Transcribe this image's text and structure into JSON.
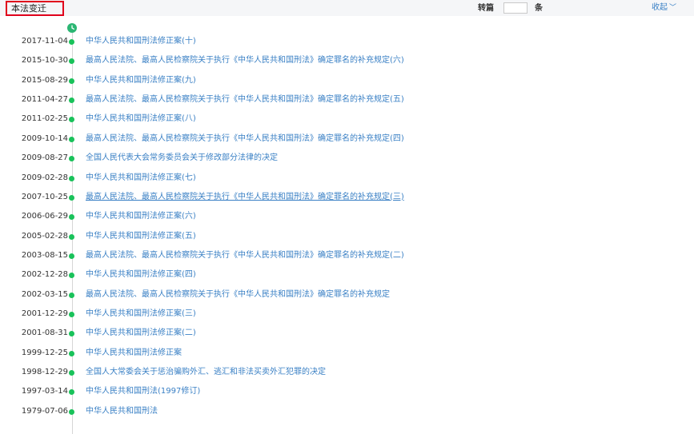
{
  "header": {
    "section_title": "本法变迁",
    "jump_label": "转篇",
    "jump_input_value": "",
    "jump_unit": "条",
    "collapse_label": "收起"
  },
  "timeline": {
    "events": [
      {
        "date": "2017-11-04",
        "title": "中华人民共和国刑法修正案(十)"
      },
      {
        "date": "2015-10-30",
        "title": "最高人民法院、最高人民检察院关于执行《中华人民共和国刑法》确定罪名的补充规定(六)"
      },
      {
        "date": "2015-08-29",
        "title": "中华人民共和国刑法修正案(九)"
      },
      {
        "date": "2011-04-27",
        "title": "最高人民法院、最高人民检察院关于执行《中华人民共和国刑法》确定罪名的补充规定(五)"
      },
      {
        "date": "2011-02-25",
        "title": "中华人民共和国刑法修正案(八)"
      },
      {
        "date": "2009-10-14",
        "title": "最高人民法院、最高人民检察院关于执行《中华人民共和国刑法》确定罪名的补充规定(四)"
      },
      {
        "date": "2009-08-27",
        "title": "全国人民代表大会常务委员会关于修改部分法律的决定"
      },
      {
        "date": "2009-02-28",
        "title": "中华人民共和国刑法修正案(七)"
      },
      {
        "date": "2007-10-25",
        "title": "最高人民法院、最高人民检察院关于执行《中华人民共和国刑法》确定罪名的补充规定(三)",
        "hovered": true
      },
      {
        "date": "2006-06-29",
        "title": "中华人民共和国刑法修正案(六)"
      },
      {
        "date": "2005-02-28",
        "title": "中华人民共和国刑法修正案(五)"
      },
      {
        "date": "2003-08-15",
        "title": "最高人民法院、最高人民检察院关于执行《中华人民共和国刑法》确定罪名的补充规定(二)"
      },
      {
        "date": "2002-12-28",
        "title": "中华人民共和国刑法修正案(四)"
      },
      {
        "date": "2002-03-15",
        "title": "最高人民法院、最高人民检察院关于执行《中华人民共和国刑法》确定罪名的补充规定"
      },
      {
        "date": "2001-12-29",
        "title": "中华人民共和国刑法修正案(三)"
      },
      {
        "date": "2001-08-31",
        "title": "中华人民共和国刑法修正案(二)"
      },
      {
        "date": "1999-12-25",
        "title": "中华人民共和国刑法修正案"
      },
      {
        "date": "1998-12-29",
        "title": "全国人大常委会关于惩治骗购外汇、逃汇和非法买卖外汇犯罪的决定"
      },
      {
        "date": "1997-03-14",
        "title": "中华人民共和国刑法(1997修订)"
      },
      {
        "date": "1979-07-06",
        "title": "中华人民共和国刑法"
      }
    ]
  },
  "icons": {
    "timeline_start": "clock-icon",
    "collapse": "chevron-down-icon"
  },
  "colors": {
    "accent_green": "#19c25a",
    "link_blue": "#3a80c5",
    "title_border_red": "#e0001b"
  }
}
